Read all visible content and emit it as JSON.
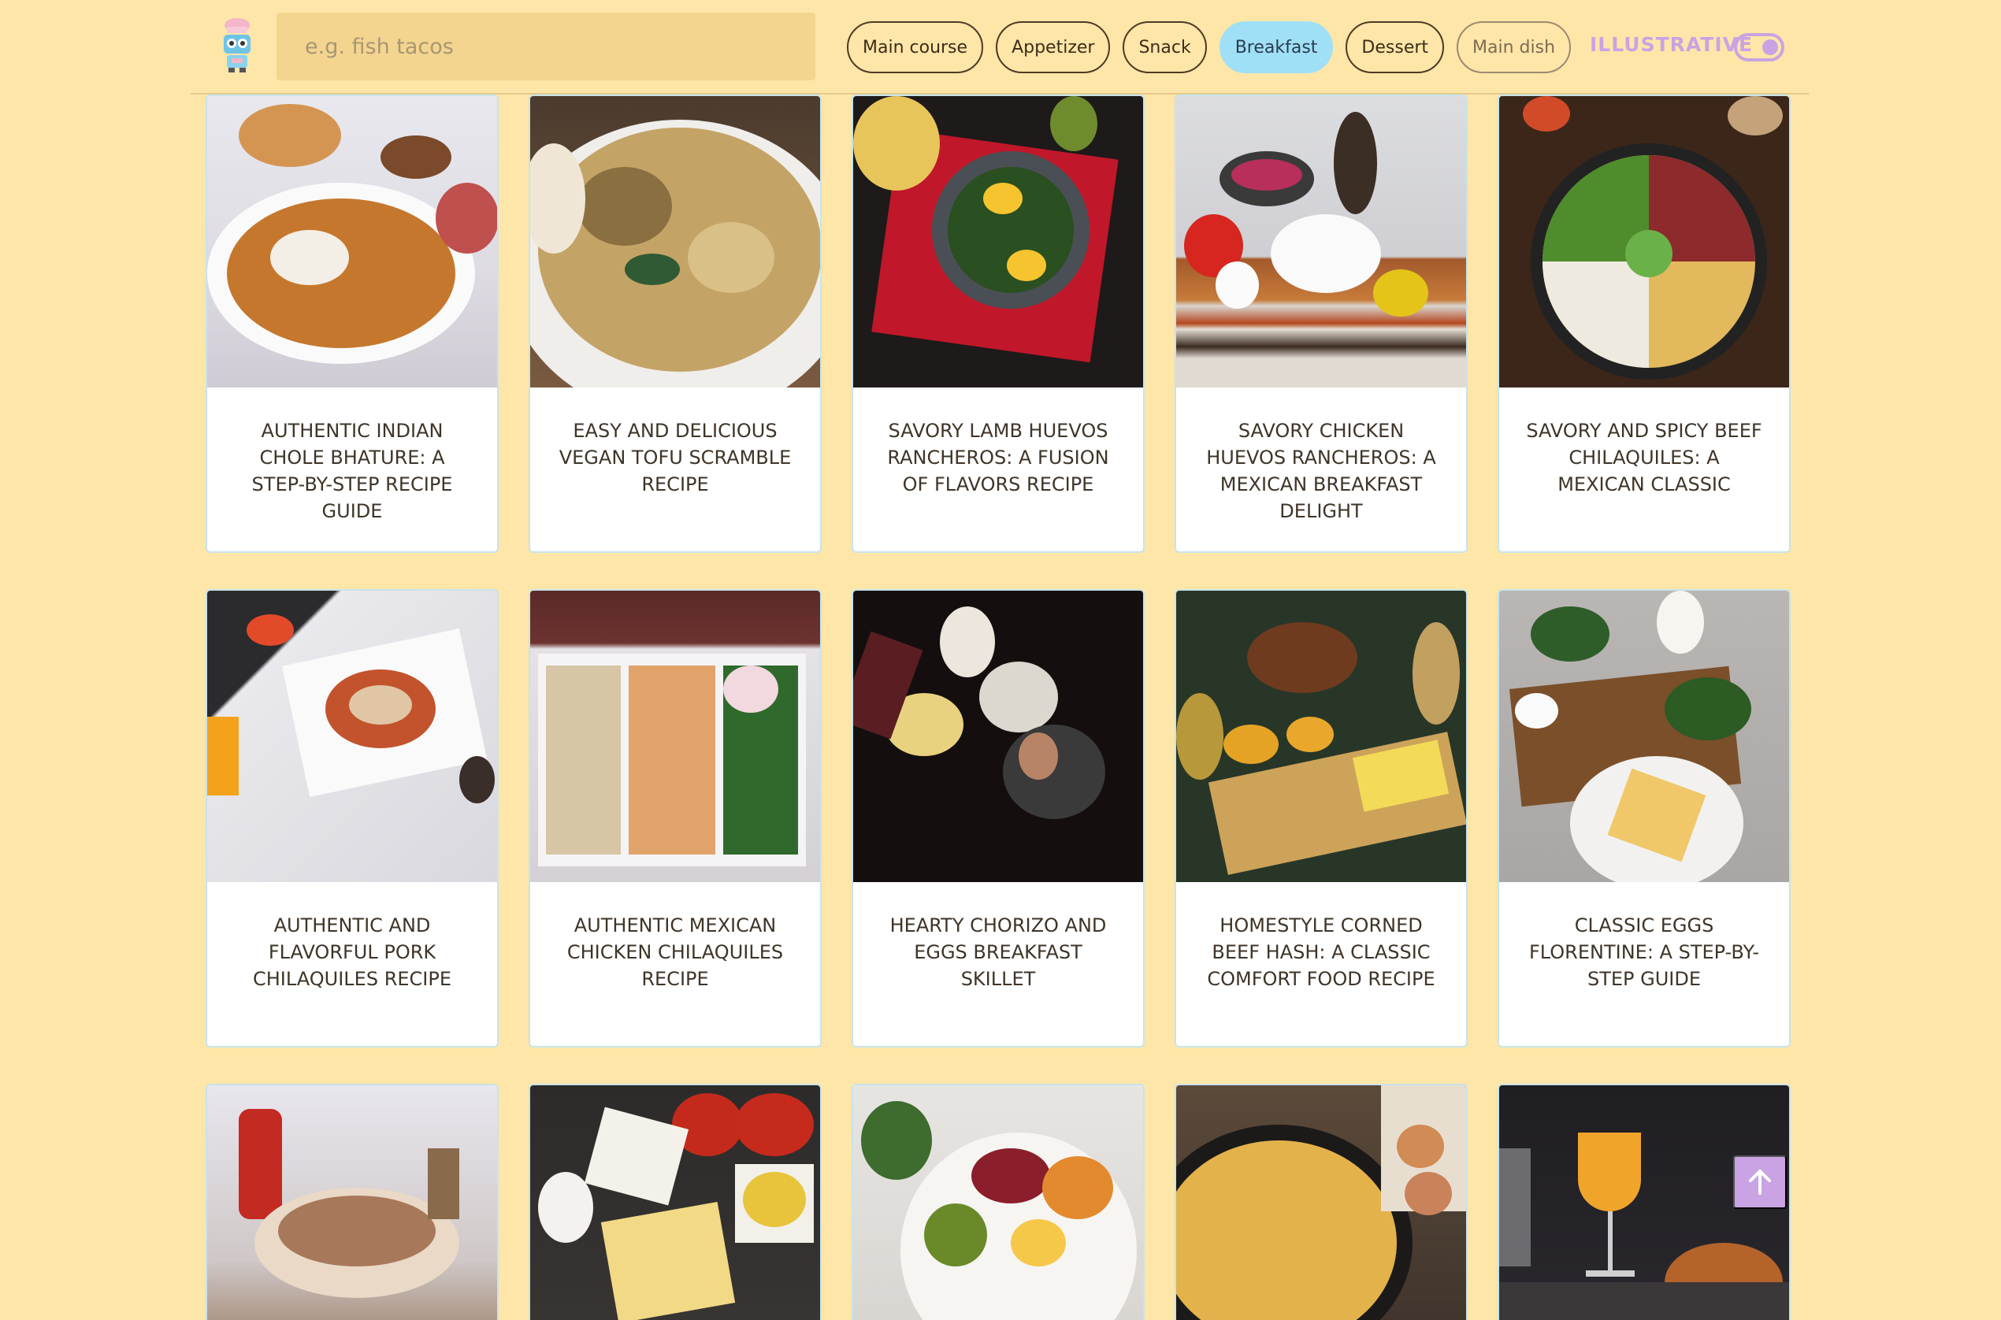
{
  "header": {
    "search_placeholder": "e.g. fish tacos",
    "filters": [
      {
        "label": "Main course",
        "active": false
      },
      {
        "label": "Appetizer",
        "active": false
      },
      {
        "label": "Snack",
        "active": false
      },
      {
        "label": "Breakfast",
        "active": true
      },
      {
        "label": "Dessert",
        "active": false
      },
      {
        "label": "Main dish",
        "active": false
      }
    ],
    "toggle_label": "ILLUSTRATIVE",
    "toggle_on": true
  },
  "recipes": [
    {
      "title": "AUTHENTIC INDIAN CHOLE BHATURE: A STEP-BY-STEP RECIPE GUIDE"
    },
    {
      "title": "EASY AND DELICIOUS VEGAN TOFU SCRAMBLE RECIPE"
    },
    {
      "title": "SAVORY LAMB HUEVOS RANCHEROS: A FUSION OF FLAVORS RECIPE"
    },
    {
      "title": "SAVORY CHICKEN HUEVOS RANCHEROS: A MEXICAN BREAKFAST DELIGHT"
    },
    {
      "title": "SAVORY AND SPICY BEEF CHILAQUILES: A MEXICAN CLASSIC"
    },
    {
      "title": "AUTHENTIC AND FLAVORFUL PORK CHILAQUILES RECIPE"
    },
    {
      "title": "AUTHENTIC MEXICAN CHICKEN CHILAQUILES RECIPE"
    },
    {
      "title": "HEARTY CHORIZO AND EGGS BREAKFAST SKILLET"
    },
    {
      "title": "HOMESTYLE CORNED BEEF HASH: A CLASSIC COMFORT FOOD RECIPE"
    },
    {
      "title": "CLASSIC EGGS FLORENTINE: A STEP-BY-STEP GUIDE"
    }
  ],
  "colors": {
    "background": "#fde6a8",
    "active_chip": "#9fe0f7",
    "accent": "#c9a3e3"
  },
  "icons": {
    "logo": "chef-robot-icon",
    "scroll_top": "arrow-up-icon"
  }
}
